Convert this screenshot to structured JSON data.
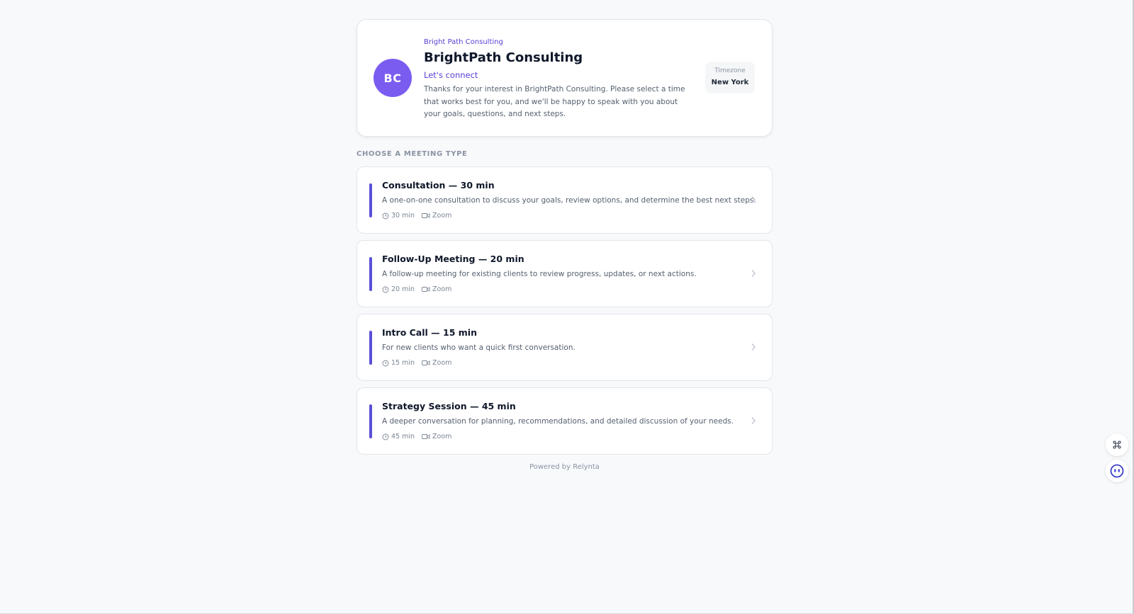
{
  "profile": {
    "avatar_initials": "BC",
    "org_name": "Bright Path Consulting",
    "title": "BrightPath Consulting",
    "tagline": "Let's connect",
    "description": "Thanks for your interest in BrightPath Consulting. Please select a time that works best for you, and we'll be happy to speak with you about your goals, questions, and next steps.",
    "timezone_label": "Timezone",
    "timezone_value": "New York"
  },
  "section_label": "CHOOSE A MEETING TYPE",
  "meetings": [
    {
      "title": "Consultation — 30 min",
      "description": "A one-on-one consultation to discuss your goals, review options, and determine the best next steps.",
      "duration": "30 min",
      "location": "Zoom"
    },
    {
      "title": "Follow-Up Meeting — 20 min",
      "description": "A follow-up meeting for existing clients to review progress, updates, or next actions.",
      "duration": "20 min",
      "location": "Zoom"
    },
    {
      "title": "Intro Call — 15 min",
      "description": "For new clients who want a quick first conversation.",
      "duration": "15 min",
      "location": "Zoom"
    },
    {
      "title": "Strategy Session — 45 min",
      "description": "A deeper conversation for planning, recommendations, and detailed discussion of your needs.",
      "duration": "45 min",
      "location": "Zoom"
    }
  ],
  "footer": "Powered by Relynta",
  "colors": {
    "accent": "#5b4fd8",
    "avatar": "#7b5cf0",
    "background": "#f8f9fb"
  },
  "icons": {
    "duration": "clock-icon",
    "location": "video-icon",
    "open": "chevron-right-icon",
    "floating_1": "command-icon",
    "floating_2": "assistant-face-icon"
  }
}
